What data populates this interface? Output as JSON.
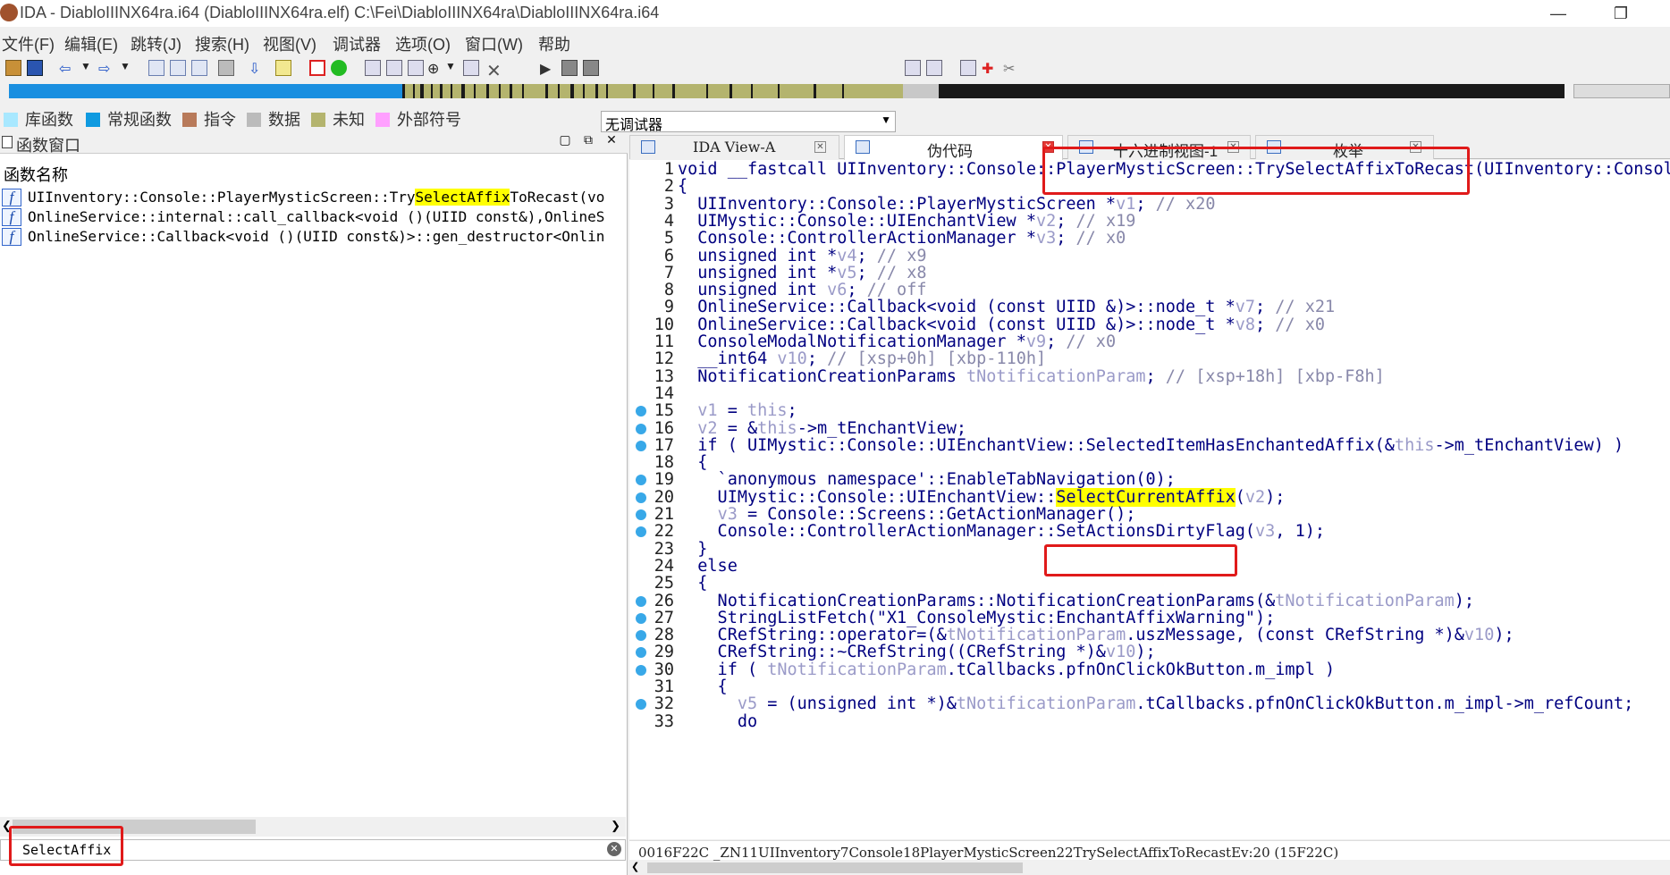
{
  "window": {
    "title": "IDA - DiabloIIINX64ra.i64 (DiabloIIINX64ra.elf) C:\\Fei\\DiabloIIINX64ra\\DiabloIIINX64ra.i64",
    "minimize": "—",
    "restore": "❐"
  },
  "menu": [
    "文件(F)",
    "编辑(E)",
    "跳转(J)",
    "搜索(H)",
    "视图(V)",
    "调试器",
    "选项(O)",
    "窗口(W)",
    "帮助"
  ],
  "toolbar": {
    "debugger": "无调试器"
  },
  "legend": [
    {
      "label": "库函数",
      "color": "#a8e8ff"
    },
    {
      "label": "常规函数",
      "color": "#0f9ae0"
    },
    {
      "label": "指令",
      "color": "#b87a5a"
    },
    {
      "label": "数据",
      "color": "#bbbbbb"
    },
    {
      "label": "未知",
      "color": "#b4b46e"
    },
    {
      "label": "外部符号",
      "color": "#ffa0ff"
    }
  ],
  "functions_panel": {
    "title": "函数窗口",
    "column": "函数名称",
    "rows": [
      {
        "pre": "UIInventory::Console::PlayerMysticScreen::Try",
        "hl": "SelectAffix",
        "post": "ToRecast(vo"
      },
      {
        "pre": "OnlineService::internal::call_callback<void ()(UIID const&),OnlineS",
        "hl": "",
        "post": ""
      },
      {
        "pre": "OnlineService::Callback<void ()(UIID const&)>::gen_destructor<Onlin",
        "hl": "",
        "post": ""
      }
    ],
    "search": "SelectAffix"
  },
  "tabs": [
    {
      "label": "IDA View-A"
    },
    {
      "label": "伪代码"
    },
    {
      "label": "十六进制视图-1"
    },
    {
      "label": "枚举"
    }
  ],
  "code": [
    {
      "n": "1",
      "d": false,
      "t": "void __fastcall UIInventory::Console::PlayerMysticScreen::TrySelectAffixToRecast(UIInventory::Console"
    },
    {
      "n": "2",
      "d": false,
      "t": "{"
    },
    {
      "n": "3",
      "d": false,
      "t": "  UIInventory::Console::PlayerMysticScreen *v1; // x20"
    },
    {
      "n": "4",
      "d": false,
      "t": "  UIMystic::Console::UIEnchantView *v2; // x19"
    },
    {
      "n": "5",
      "d": false,
      "t": "  Console::ControllerActionManager *v3; // x0"
    },
    {
      "n": "6",
      "d": false,
      "t": "  unsigned int *v4; // x9"
    },
    {
      "n": "7",
      "d": false,
      "t": "  unsigned int *v5; // x8"
    },
    {
      "n": "8",
      "d": false,
      "t": "  unsigned int v6; // off"
    },
    {
      "n": "9",
      "d": false,
      "t": "  OnlineService::Callback<void (const UIID &)>::node_t *v7; // x21"
    },
    {
      "n": "10",
      "d": false,
      "t": "  OnlineService::Callback<void (const UIID &)>::node_t *v8; // x0"
    },
    {
      "n": "11",
      "d": false,
      "t": "  ConsoleModalNotificationManager *v9; // x0"
    },
    {
      "n": "12",
      "d": false,
      "t": "  __int64 v10; // [xsp+0h] [xbp-110h]"
    },
    {
      "n": "13",
      "d": false,
      "t": "  NotificationCreationParams tNotificationParam; // [xsp+18h] [xbp-F8h]"
    },
    {
      "n": "14",
      "d": false,
      "t": ""
    },
    {
      "n": "15",
      "d": true,
      "t": "  v1 = this;"
    },
    {
      "n": "16",
      "d": true,
      "t": "  v2 = &this->m_tEnchantView;"
    },
    {
      "n": "17",
      "d": true,
      "t": "  if ( UIMystic::Console::UIEnchantView::SelectedItemHasEnchantedAffix(&this->m_tEnchantView) )"
    },
    {
      "n": "18",
      "d": false,
      "t": "  {"
    },
    {
      "n": "19",
      "d": true,
      "t": "    `anonymous namespace'::EnableTabNavigation(0);"
    },
    {
      "n": "20",
      "d": true,
      "t": "    UIMystic::Console::UIEnchantView::SelectCurrentAffix(v2);"
    },
    {
      "n": "21",
      "d": true,
      "t": "    v3 = Console::Screens::GetActionManager();"
    },
    {
      "n": "22",
      "d": true,
      "t": "    Console::ControllerActionManager::SetActionsDirtyFlag(v3, 1);"
    },
    {
      "n": "23",
      "d": false,
      "t": "  }"
    },
    {
      "n": "24",
      "d": false,
      "t": "  else"
    },
    {
      "n": "25",
      "d": false,
      "t": "  {"
    },
    {
      "n": "26",
      "d": true,
      "t": "    NotificationCreationParams::NotificationCreationParams(&tNotificationParam);"
    },
    {
      "n": "27",
      "d": true,
      "t": "    StringListFetch(\"X1_ConsoleMystic:EnchantAffixWarning\");"
    },
    {
      "n": "28",
      "d": true,
      "t": "    CRefString::operator=(&tNotificationParam.uszMessage, (const CRefString *)&v10);"
    },
    {
      "n": "29",
      "d": true,
      "t": "    CRefString::~CRefString((CRefString *)&v10);"
    },
    {
      "n": "30",
      "d": true,
      "t": "    if ( tNotificationParam.tCallbacks.pfnOnClickOkButton.m_impl )"
    },
    {
      "n": "31",
      "d": false,
      "t": "    {"
    },
    {
      "n": "32",
      "d": true,
      "t": "      v5 = (unsigned int *)&tNotificationParam.tCallbacks.pfnOnClickOkButton.m_impl->m_refCount;"
    },
    {
      "n": "33",
      "d": false,
      "t": "      do"
    }
  ],
  "status": "0016F22C _ZN11UIInventory7Console18PlayerMysticScreen22TrySelectAffixToRecastEv:20 (15F22C)"
}
